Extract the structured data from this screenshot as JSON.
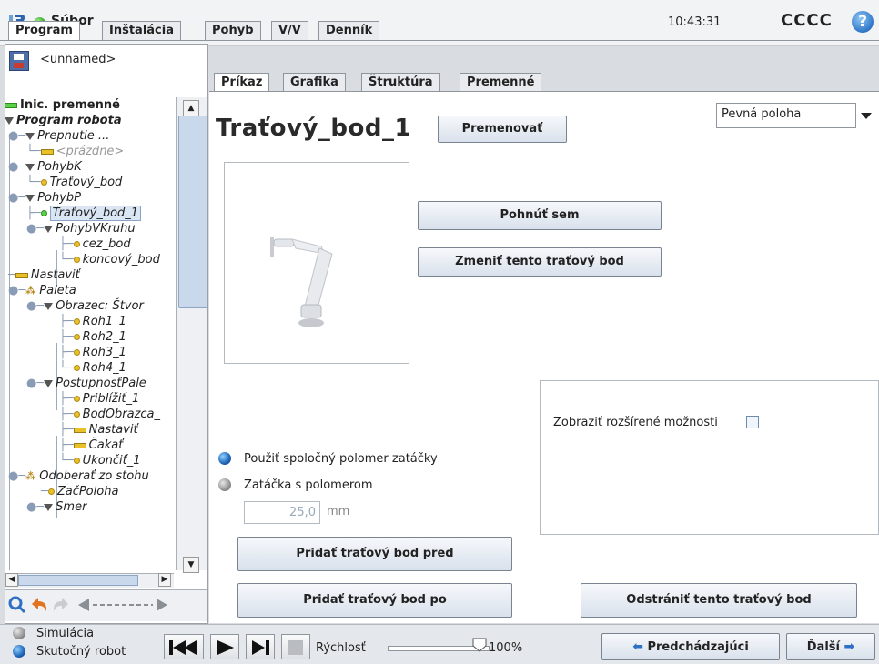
{
  "topbar": {
    "file_menu": "Súbor",
    "clock": "10:43:31",
    "robot_name": "CCCC",
    "help": "?"
  },
  "main_tabs": [
    "Program",
    "Inštalácia",
    "Pohyb",
    "V/V",
    "Denník"
  ],
  "program": {
    "name": "<unnamed>"
  },
  "tree": {
    "nodes": [
      {
        "label": "Inic. premenné"
      },
      {
        "label": "Program robota"
      },
      {
        "label": "Prepnutie ..."
      },
      {
        "label": "<prázdne>"
      },
      {
        "label": "PohybK"
      },
      {
        "label": "Traťový_bod"
      },
      {
        "label": "PohybP"
      },
      {
        "label": "Traťový_bod_1"
      },
      {
        "label": "PohybVKruhu"
      },
      {
        "label": "cez_bod"
      },
      {
        "label": "koncový_bod"
      },
      {
        "label": "Nastaviť"
      },
      {
        "label": "Paleta"
      },
      {
        "label": "Obrazec: Štvor"
      },
      {
        "label": "Roh1_1"
      },
      {
        "label": "Roh2_1"
      },
      {
        "label": "Roh3_1"
      },
      {
        "label": "Roh4_1"
      },
      {
        "label": "PostupnosťPale"
      },
      {
        "label": "Priblížiť_1"
      },
      {
        "label": "BodObrazca_"
      },
      {
        "label": "Nastaviť"
      },
      {
        "label": "Čakať"
      },
      {
        "label": "Ukončiť_1"
      },
      {
        "label": "Odoberať zo stohu"
      },
      {
        "label": "ZačPoloha"
      },
      {
        "label": "Smer"
      }
    ]
  },
  "sub_tabs": [
    "Príkaz",
    "Grafika",
    "Štruktúra",
    "Premenné"
  ],
  "waypoint": {
    "title": "Traťový_bod_1",
    "rename_label": "Premenovať",
    "position_type": "Pevná poloha",
    "move_here_label": "Pohnúť sem",
    "change_label": "Zmeniť tento traťový bod",
    "advanced_label": "Zobraziť rozšírené možnosti",
    "blend_shared_label": "Použiť spoločný polomer zatáčky",
    "blend_radius_label": "Zatáčka s polomerom",
    "radius_value": "25,0",
    "radius_unit": "mm",
    "add_before_label": "Pridať traťový bod pred",
    "add_after_label": "Pridať traťový bod po",
    "remove_label": "Odstrániť tento traťový bod"
  },
  "footer": {
    "simulation_label": "Simulácia",
    "real_robot_label": "Skutočný robot",
    "speed_label": "Rýchlosť",
    "speed_value": "100%",
    "speed_fraction": 1.0,
    "prev_label": "Predchádzajúci",
    "next_label": "Ďalší"
  }
}
